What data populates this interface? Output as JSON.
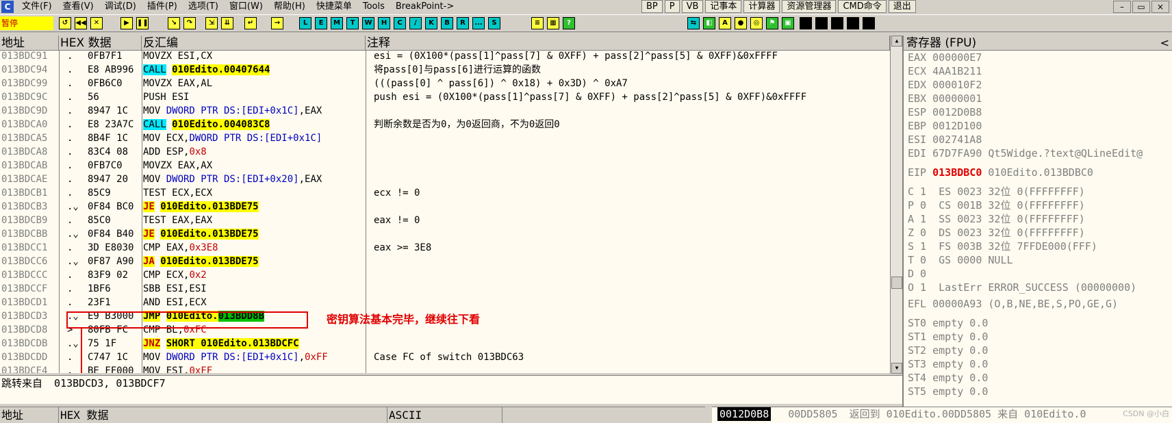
{
  "menu": {
    "icon": "C",
    "items": [
      "文件(F)",
      "查看(V)",
      "调试(D)",
      "插件(P)",
      "选项(T)",
      "窗口(W)",
      "帮助(H)",
      "快捷菜单",
      "Tools",
      "BreakPoint->"
    ],
    "tool_buttons": [
      "BP",
      "P",
      "VB",
      "记事本",
      "计算器",
      "资源管理器",
      "CMD命令",
      "退出"
    ],
    "window_controls": [
      "–",
      "▭",
      "×"
    ]
  },
  "toolbar": {
    "status": "暂停",
    "letter_buttons": [
      "L",
      "E",
      "M",
      "T",
      "W",
      "H",
      "C",
      "/",
      "K",
      "B",
      "R",
      "...",
      "S"
    ]
  },
  "cpu_header": {
    "address": "地址",
    "hex": "HEX 数据",
    "disasm": "反汇编",
    "comment": "注释"
  },
  "rows": [
    {
      "addr": "013BDC91",
      "mark": ".",
      "hex": "0FB7F1",
      "dis": "MOVZX ESI,CX",
      "cmt": "esi = (0X100*(pass[1]^pass[7] & 0XFF) + pass[2]^pass[5] & 0XFF)&0xFFFF"
    },
    {
      "addr": "013BDC94",
      "mark": ".",
      "hex": "E8 AB996",
      "dis_op": "CALL",
      "dis_arg": "010Edito.00407644",
      "cmt": "将pass[0]与pass[6]进行运算的函数"
    },
    {
      "addr": "013BDC99",
      "mark": ".",
      "hex": "0FB6C0",
      "dis": "MOVZX EAX,AL",
      "cmt": "(((pass[0] ^ pass[6]) ^ 0x18) + 0x3D) ^ 0xA7"
    },
    {
      "addr": "013BDC9C",
      "mark": ".",
      "hex": "56",
      "dis": "PUSH ESI",
      "cmt": "push esi = (0X100*(pass[1]^pass[7] & 0XFF) + pass[2]^pass[5] & 0XFF)&0xFFFF"
    },
    {
      "addr": "013BDC9D",
      "mark": ".",
      "hex": "8947 1C",
      "dis_pre": "MOV ",
      "dis_ptr": "DWORD PTR DS:[EDI+0x1C]",
      "dis_post": ",EAX",
      "cmt": ""
    },
    {
      "addr": "013BDCA0",
      "mark": ".",
      "hex": "E8 23A7C",
      "dis_op": "CALL",
      "dis_arg": "010Edito.004083C8",
      "cmt": "判断余数是否为0，为0返回商，不为0返回0"
    },
    {
      "addr": "013BDCA5",
      "mark": ".",
      "hex": "8B4F 1C",
      "dis_pre": "MOV ECX,",
      "dis_ptr": "DWORD PTR DS:[EDI+0x1C]",
      "dis_post": "",
      "cmt": ""
    },
    {
      "addr": "013BDCA8",
      "mark": ".",
      "hex": "83C4 08",
      "dis_pre": "ADD ESP,",
      "dis_num": "0x8",
      "cmt": ""
    },
    {
      "addr": "013BDCAB",
      "mark": ".",
      "hex": "0FB7C0",
      "dis": "MOVZX EAX,AX",
      "cmt": ""
    },
    {
      "addr": "013BDCAE",
      "mark": ".",
      "hex": "8947 20",
      "dis_pre": "MOV ",
      "dis_ptr": "DWORD PTR DS:[EDI+0x20]",
      "dis_post": ",EAX",
      "cmt": ""
    },
    {
      "addr": "013BDCB1",
      "mark": ".",
      "hex": "85C9",
      "dis": "TEST ECX,ECX",
      "cmt": "ecx != 0"
    },
    {
      "addr": "013BDCB3",
      "mark": ".⌄",
      "hex": "0F84 BC0",
      "dis_jop": "JE",
      "dis_jarg": "010Edito.013BDE75",
      "cmt": ""
    },
    {
      "addr": "013BDCB9",
      "mark": ".",
      "hex": "85C0",
      "dis": "TEST EAX,EAX",
      "cmt": "eax != 0"
    },
    {
      "addr": "013BDCBB",
      "mark": ".⌄",
      "hex": "0F84 B40",
      "dis_jop": "JE",
      "dis_jarg": "010Edito.013BDE75",
      "cmt": ""
    },
    {
      "addr": "013BDCC1",
      "mark": ".",
      "hex": "3D E8030",
      "dis_pre": "CMP EAX,",
      "dis_num": "0x3E8",
      "cmt": "eax >= 3E8"
    },
    {
      "addr": "013BDCC6",
      "mark": ".⌄",
      "hex": "0F87 A90",
      "dis_jop": "JA",
      "dis_jarg": "010Edito.013BDE75",
      "cmt": ""
    },
    {
      "addr": "013BDCCC",
      "mark": ".",
      "hex": "83F9 02",
      "dis_pre": "CMP ECX,",
      "dis_num": "0x2",
      "cmt": ""
    },
    {
      "addr": "013BDCCF",
      "mark": ".",
      "hex": "1BF6",
      "dis": "SBB ESI,ESI",
      "cmt": ""
    },
    {
      "addr": "013BDCD1",
      "mark": ".",
      "hex": "23F1",
      "dis": "AND ESI,ECX",
      "cmt": ""
    },
    {
      "addr": "013BDCD3",
      "mark": ".⌄",
      "hex": "E9 B3000",
      "dis_jmp": "JMP",
      "dis_jarg": "010Edito.",
      "dis_jtail": "013BDD8B",
      "cmt": ""
    },
    {
      "addr": "013BDCD8",
      "mark": ">",
      "hex": "80FB FC",
      "dis_pre": "CMP BL,",
      "dis_num": "0xFC",
      "cmt": ""
    },
    {
      "addr": "013BDCDB",
      "mark": ".⌄",
      "hex": "75 1F",
      "dis_jop": "JNZ",
      "dis_jarg": "SHORT 010Edito.013BDCFC",
      "cmt": ""
    },
    {
      "addr": "013BDCDD",
      "mark": ".",
      "hex": "C747 1C",
      "dis_pre": "MOV ",
      "dis_ptr": "DWORD PTR DS:[EDI+0x1C]",
      "dis_post": ",",
      "dis_num": "0xFF",
      "cmt": "Case FC of switch 013BDC63"
    },
    {
      "addr": "013BDCE4",
      "mark": ".",
      "hex": "BE FF000",
      "dis_pre": "MOV ESI,",
      "dis_num": "0xFF",
      "cmt": ""
    }
  ],
  "annotation": "密钥算法基本完毕，继续往下看",
  "info": {
    "label": "跳转来自",
    "value": "013BDCD3, 013BDCF7"
  },
  "dump_header": {
    "address": "地址",
    "hex": "HEX 数据",
    "ascii": "ASCII"
  },
  "stack": {
    "addr": "0012D0B8",
    "value": "00DD5805",
    "comment": "返回到 010Edito.00DD5805 来自 010Edito.0"
  },
  "watermark": "CSDN @小白",
  "registers": {
    "title": "寄存器 (FPU)",
    "close": "<",
    "general": [
      {
        "name": "EAX",
        "value": "000000E7"
      },
      {
        "name": "ECX",
        "value": "4AA1B211"
      },
      {
        "name": "EDX",
        "value": "000010F2"
      },
      {
        "name": "EBX",
        "value": "00000001"
      },
      {
        "name": "ESP",
        "value": "0012D0B8"
      },
      {
        "name": "EBP",
        "value": "0012D100"
      },
      {
        "name": "ESI",
        "value": "002741A8"
      },
      {
        "name": "EDI",
        "value": "67D7FA90 Qt5Widge.?text@QLineEdit@"
      }
    ],
    "eip": {
      "name": "EIP",
      "value": "013BDBC0",
      "desc": "010Edito.013BDBC0"
    },
    "segments": [
      "C 1  ES 0023 32位 0(FFFFFFFF)",
      "P 0  CS 001B 32位 0(FFFFFFFF)",
      "A 1  SS 0023 32位 0(FFFFFFFF)",
      "Z 0  DS 0023 32位 0(FFFFFFFF)",
      "S 1  FS 003B 32位 7FFDE000(FFF)",
      "T 0  GS 0000 NULL",
      "D 0",
      "O 1  LastErr ERROR_SUCCESS (00000000)"
    ],
    "efl": "EFL 00000A93 (O,B,NE,BE,S,PO,GE,G)",
    "fpu": [
      "ST0 empty 0.0",
      "ST1 empty 0.0",
      "ST2 empty 0.0",
      "ST3 empty 0.0",
      "ST4 empty 0.0",
      "ST5 empty 0.0"
    ]
  },
  "colors": {
    "highlight_yellow": "#ffff00",
    "highlight_cyan": "#00e8ff",
    "highlight_green": "#00c000",
    "annotation_red": "#e00000",
    "pane_bg": "#fffbf0"
  }
}
